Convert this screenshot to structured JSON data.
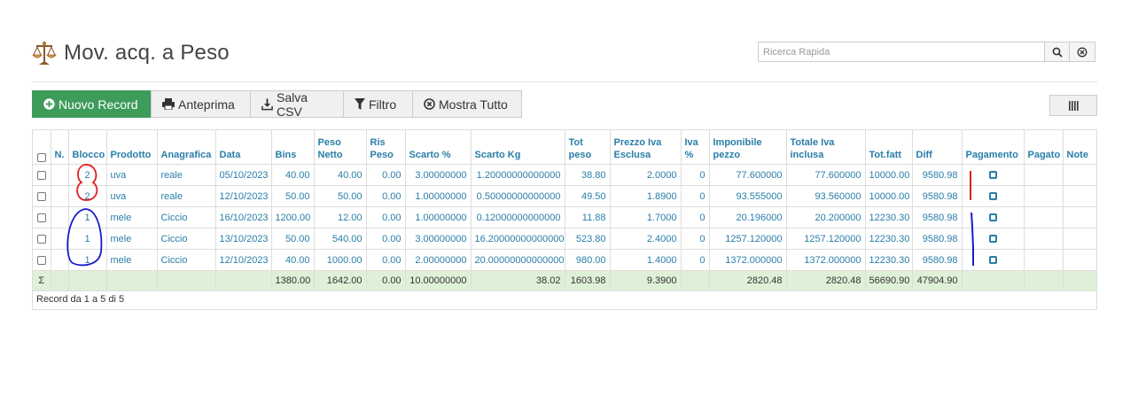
{
  "header": {
    "title": "Mov. acq. a Peso",
    "title_icon": "scales-icon",
    "search_placeholder": "Ricerca Rapida"
  },
  "toolbar": {
    "new_record": "Nuovo Record",
    "preview": "Anteprima",
    "save_csv": "Salva CSV",
    "filter": "Filtro",
    "show_all": "Mostra Tutto"
  },
  "table": {
    "columns": {
      "n": "N.",
      "blocco": "Blocco",
      "prodotto": "Prodotto",
      "anagrafica": "Anagrafica",
      "data": "Data",
      "bins": "Bins",
      "peso_netto": "Peso Netto",
      "ris_peso": "Ris Peso",
      "scarto_pct": "Scarto %",
      "scarto_kg": "Scarto Kg",
      "tot_peso": "Tot peso",
      "prezzo_iva_esclusa": "Prezzo Iva Esclusa",
      "iva_pct": "Iva %",
      "imponibile_pezzo": "Imponibile pezzo",
      "totale_iva_inclusa": "Totale Iva inclusa",
      "tot_fatt": "Tot.fatt",
      "diff": "Diff",
      "pagamento": "Pagamento",
      "pagato": "Pagato",
      "note": "Note"
    },
    "rows": [
      {
        "blocco": "2",
        "prodotto": "uva",
        "anagrafica": "reale",
        "data": "05/10/2023",
        "bins": "40.00",
        "peso_netto": "40.00",
        "ris_peso": "0.00",
        "scarto_pct": "3.00000000",
        "scarto_kg": "1.20000000000000",
        "tot_peso": "38.80",
        "prezzo": "2.0000",
        "iva": "0",
        "imponibile": "77.600000",
        "totale_iva": "77.600000",
        "tot_fatt": "10000.00",
        "diff": "9580.98"
      },
      {
        "blocco": "2",
        "prodotto": "uva",
        "anagrafica": "reale",
        "data": "12/10/2023",
        "bins": "50.00",
        "peso_netto": "50.00",
        "ris_peso": "0.00",
        "scarto_pct": "1.00000000",
        "scarto_kg": "0.50000000000000",
        "tot_peso": "49.50",
        "prezzo": "1.8900",
        "iva": "0",
        "imponibile": "93.555000",
        "totale_iva": "93.560000",
        "tot_fatt": "10000.00",
        "diff": "9580.98"
      },
      {
        "blocco": "1",
        "prodotto": "mele",
        "anagrafica": "Ciccio",
        "data": "16/10/2023",
        "bins": "1200.00",
        "peso_netto": "12.00",
        "ris_peso": "0.00",
        "scarto_pct": "1.00000000",
        "scarto_kg": "0.12000000000000",
        "tot_peso": "11.88",
        "prezzo": "1.7000",
        "iva": "0",
        "imponibile": "20.196000",
        "totale_iva": "20.200000",
        "tot_fatt": "12230.30",
        "diff": "9580.98"
      },
      {
        "blocco": "1",
        "prodotto": "mele",
        "anagrafica": "Ciccio",
        "data": "13/10/2023",
        "bins": "50.00",
        "peso_netto": "540.00",
        "ris_peso": "0.00",
        "scarto_pct": "3.00000000",
        "scarto_kg": "16.20000000000000",
        "tot_peso": "523.80",
        "prezzo": "2.4000",
        "iva": "0",
        "imponibile": "1257.120000",
        "totale_iva": "1257.120000",
        "tot_fatt": "12230.30",
        "diff": "9580.98"
      },
      {
        "blocco": "1",
        "prodotto": "mele",
        "anagrafica": "Ciccio",
        "data": "12/10/2023",
        "bins": "40.00",
        "peso_netto": "1000.00",
        "ris_peso": "0.00",
        "scarto_pct": "2.00000000",
        "scarto_kg": "20.00000000000000",
        "tot_peso": "980.00",
        "prezzo": "1.4000",
        "iva": "0",
        "imponibile": "1372.000000",
        "totale_iva": "1372.000000",
        "tot_fatt": "12230.30",
        "diff": "9580.98"
      }
    ],
    "totals": {
      "symbol": "Σ",
      "bins": "1380.00",
      "peso_netto": "1642.00",
      "ris_peso": "0.00",
      "scarto_pct": "10.00000000",
      "scarto_kg": "38.02",
      "tot_peso": "1603.98",
      "prezzo": "9.3900",
      "imponibile": "2820.48",
      "totale_iva": "2820.48",
      "tot_fatt": "56690.90",
      "diff": "47904.90"
    },
    "footer": "Record da 1 a 5 di 5"
  },
  "colors": {
    "primary_green": "#3d9c5a",
    "link_blue": "#2a7ea8",
    "total_row_bg": "#dff0d8",
    "annotation_red": "#e02020",
    "annotation_blue": "#1a1ad0"
  }
}
